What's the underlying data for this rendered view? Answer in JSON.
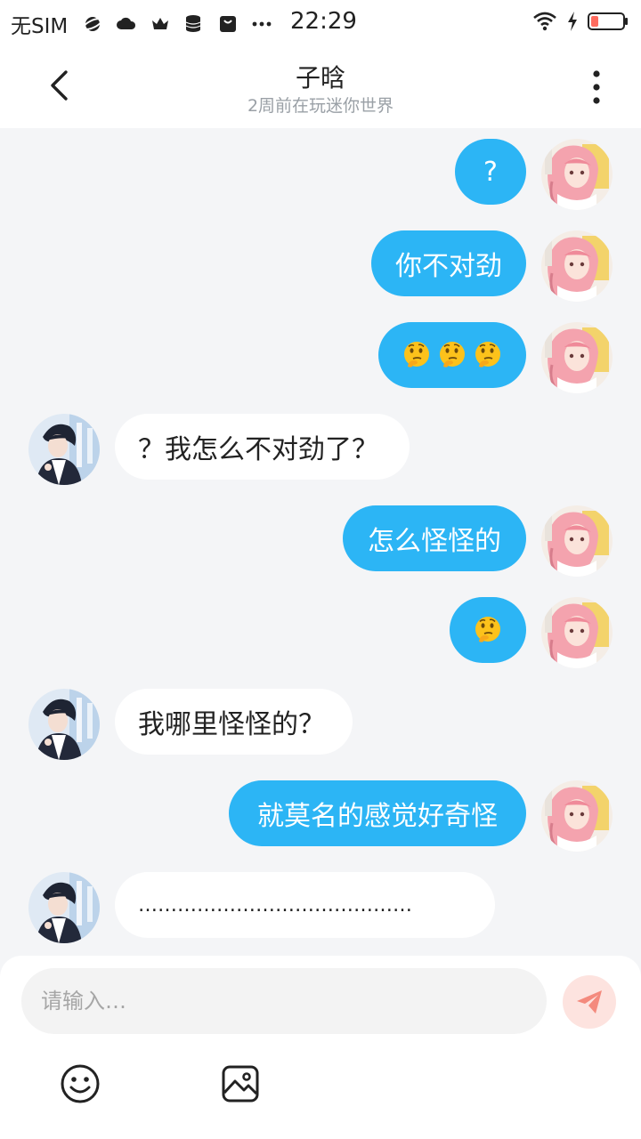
{
  "status_bar": {
    "carrier": "无SIM",
    "time": "22:29",
    "icons": [
      "planet-icon",
      "cloud-icon",
      "crown-icon",
      "database-icon",
      "bag-icon",
      "more-dots-icon"
    ],
    "right_icons": [
      "wifi-icon",
      "charging-icon",
      "battery-low-icon"
    ]
  },
  "header": {
    "title": "子晗",
    "subtitle": "2周前在玩迷你世界",
    "back_icon": "chevron-left-icon",
    "menu_icon": "vertical-dots-icon"
  },
  "messages": [
    {
      "from": "me",
      "text": "?"
    },
    {
      "from": "me",
      "text": "你不对劲"
    },
    {
      "from": "me",
      "emoji": [
        "thinking-face",
        "thinking-face",
        "thinking-face"
      ]
    },
    {
      "from": "other",
      "text": "？我怎么不对劲了？"
    },
    {
      "from": "me",
      "text": "怎么怪怪的"
    },
    {
      "from": "me",
      "emoji": [
        "thinking-face"
      ]
    },
    {
      "from": "other",
      "text": "我哪里怪怪的？"
    },
    {
      "from": "me",
      "text": "就莫名的感觉好奇怪"
    },
    {
      "from": "other",
      "text": "……………………………………"
    }
  ],
  "composer": {
    "placeholder": "请输入…",
    "send_icon": "paper-plane-icon",
    "tools": [
      "smiley-icon",
      "image-icon"
    ]
  },
  "colors": {
    "my_bubble": "#2cb5f5",
    "their_bubble": "#ffffff",
    "chat_background": "#f4f5f7",
    "send_button": "#fde3df"
  }
}
